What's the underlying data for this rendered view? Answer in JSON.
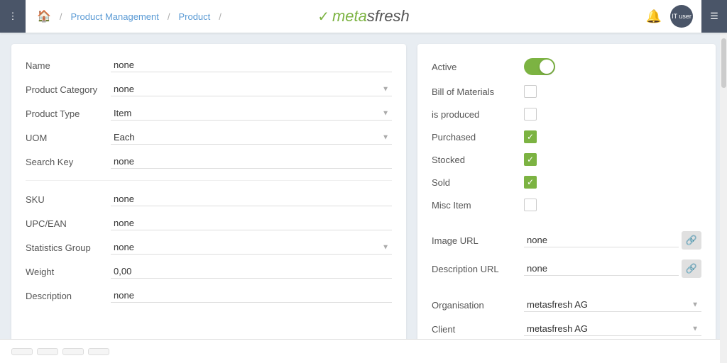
{
  "topbar": {
    "menu_dots": "⋮",
    "home_icon": "⌂",
    "breadcrumb": [
      {
        "label": "Product Management",
        "link": true
      },
      {
        "label": "Product",
        "link": true
      }
    ],
    "logo_prefix": "metasfresh",
    "bell_label": "notifications",
    "user_label": "IT user",
    "user_initials": "IT user",
    "hamburger_label": "menu"
  },
  "left_panel": {
    "fields": [
      {
        "label": "Name",
        "type": "input",
        "value": "none",
        "id": "name"
      },
      {
        "label": "Product Category",
        "type": "select",
        "value": "none",
        "id": "product-category"
      },
      {
        "label": "Product Type",
        "type": "select",
        "value": "Item",
        "id": "product-type"
      },
      {
        "label": "UOM",
        "type": "select",
        "value": "Each",
        "id": "uom"
      },
      {
        "label": "Search Key",
        "type": "input",
        "value": "none",
        "id": "search-key"
      }
    ],
    "fields2": [
      {
        "label": "SKU",
        "type": "input",
        "value": "none",
        "id": "sku"
      },
      {
        "label": "UPC/EAN",
        "type": "input",
        "value": "none",
        "id": "upc-ean"
      },
      {
        "label": "Statistics Group",
        "type": "select",
        "value": "none",
        "id": "statistics-group"
      },
      {
        "label": "Weight",
        "type": "input",
        "value": "0,00",
        "id": "weight"
      },
      {
        "label": "Description",
        "type": "input",
        "value": "none",
        "id": "description"
      }
    ]
  },
  "right_panel": {
    "checkboxes": [
      {
        "label": "Active",
        "type": "toggle",
        "checked": true,
        "id": "active"
      },
      {
        "label": "Bill of Materials",
        "type": "checkbox",
        "checked": false,
        "id": "bill-of-materials"
      },
      {
        "label": "is produced",
        "type": "checkbox",
        "checked": false,
        "id": "is-produced"
      },
      {
        "label": "Purchased",
        "type": "checkbox",
        "checked": true,
        "id": "purchased"
      },
      {
        "label": "Stocked",
        "type": "checkbox",
        "checked": true,
        "id": "stocked"
      },
      {
        "label": "Sold",
        "type": "checkbox",
        "checked": true,
        "id": "sold"
      },
      {
        "label": "Misc Item",
        "type": "checkbox",
        "checked": false,
        "id": "misc-item"
      }
    ],
    "url_fields": [
      {
        "label": "Image URL",
        "value": "none",
        "id": "image-url"
      },
      {
        "label": "Description URL",
        "value": "none",
        "id": "description-url"
      }
    ],
    "dropdowns": [
      {
        "label": "Organisation",
        "value": "metasfresh AG",
        "id": "organisation"
      },
      {
        "label": "Client",
        "value": "metasfresh AG",
        "id": "client"
      }
    ]
  }
}
